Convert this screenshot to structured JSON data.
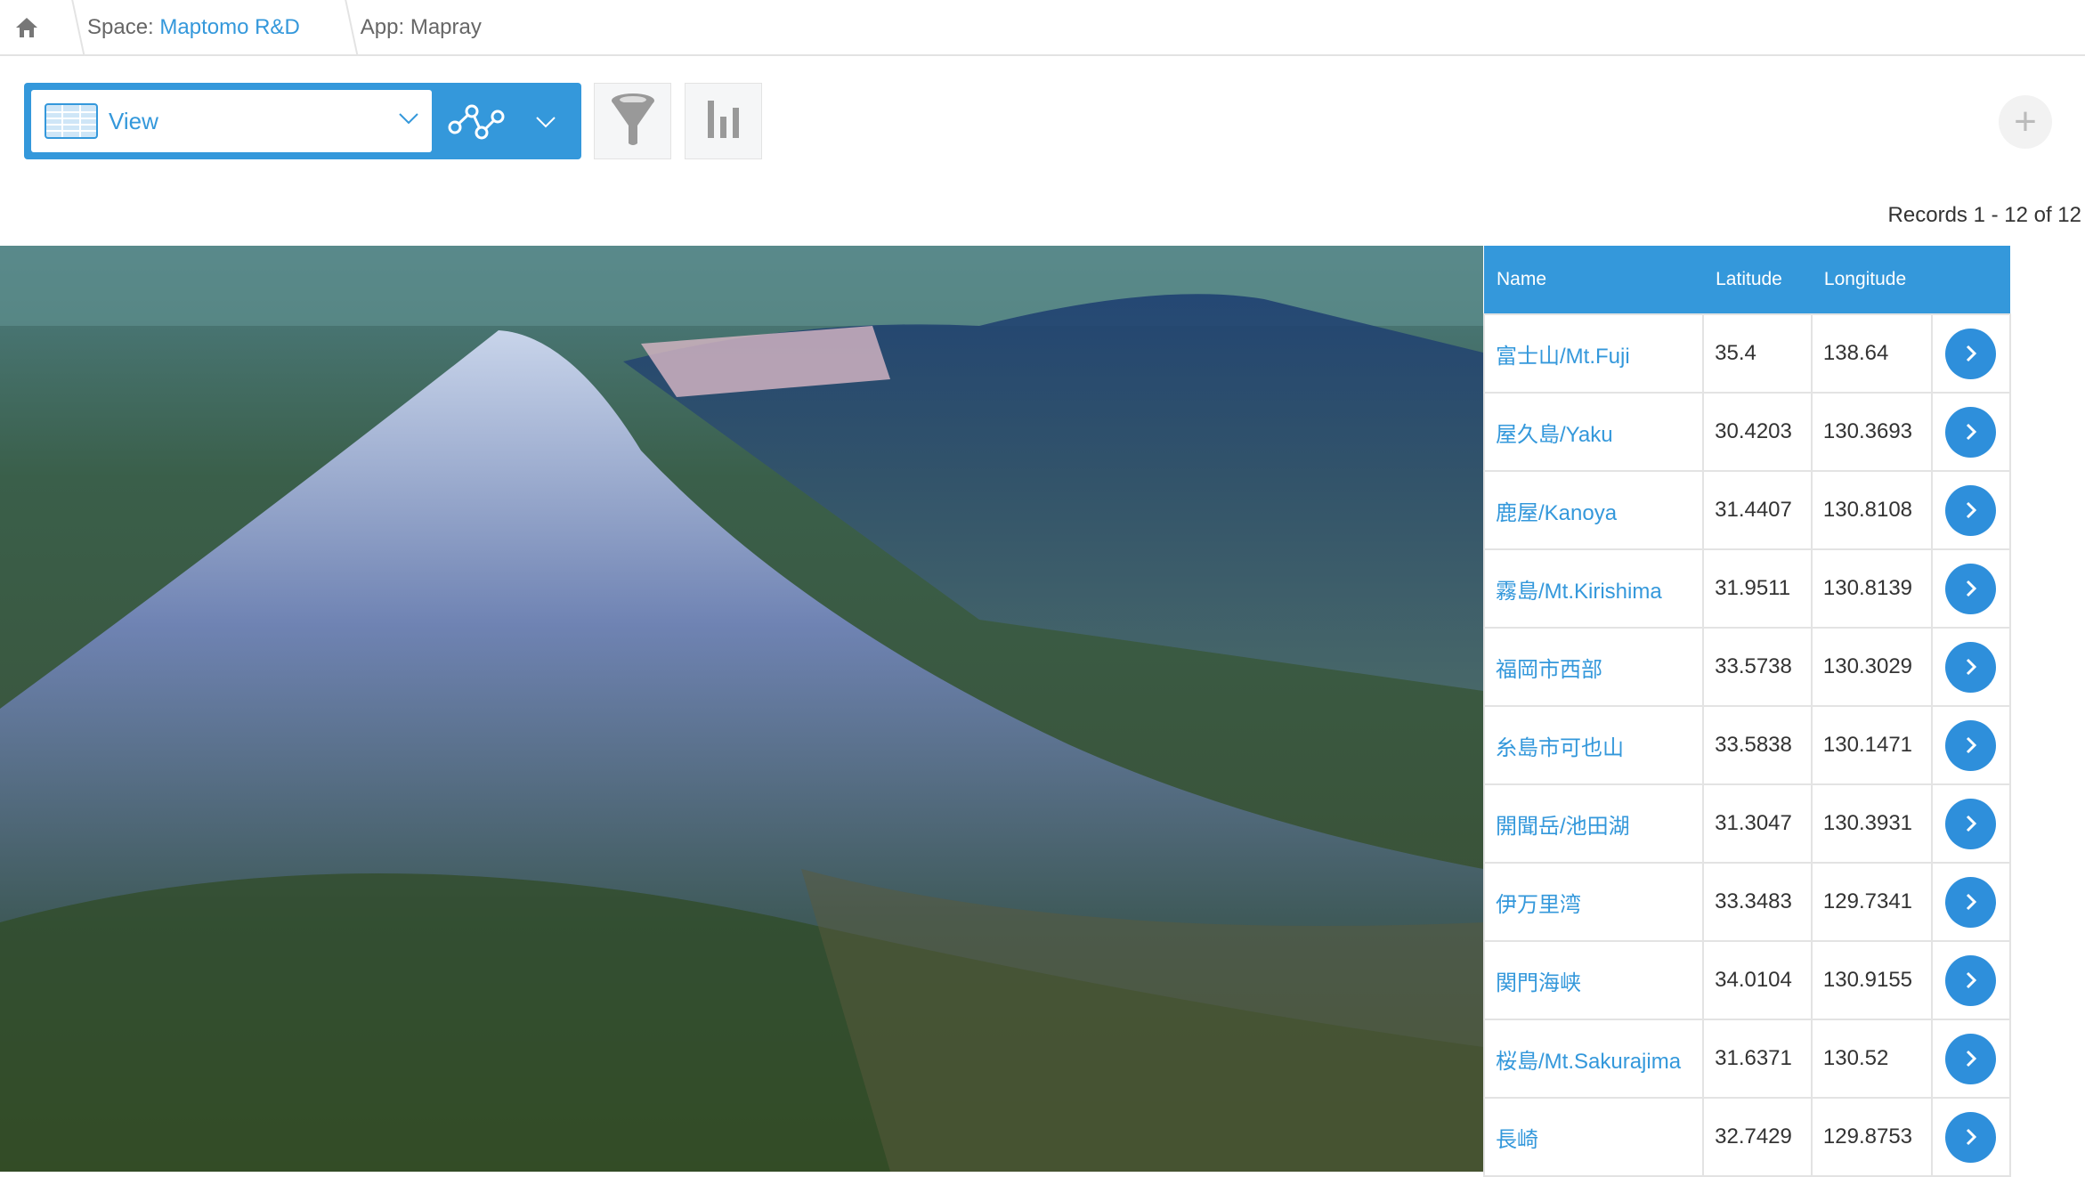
{
  "breadcrumb": {
    "space_prefix": "Space: ",
    "space_name": "Maptomo R&D",
    "app": "App: Mapray"
  },
  "toolbar": {
    "view_label": "View"
  },
  "records": "Records 1 - 12 of 12",
  "table": {
    "headers": [
      "Name",
      "Latitude",
      "Longitude"
    ],
    "rows": [
      {
        "name": "富士山/Mt.Fuji",
        "lat": "35.4",
        "lon": "138.64"
      },
      {
        "name": "屋久島/Yaku",
        "lat": "30.4203",
        "lon": "130.3693"
      },
      {
        "name": "鹿屋/Kanoya",
        "lat": "31.4407",
        "lon": "130.8108"
      },
      {
        "name": "霧島/Mt.Kirishima",
        "lat": "31.9511",
        "lon": "130.8139"
      },
      {
        "name": "福岡市西部",
        "lat": "33.5738",
        "lon": "130.3029"
      },
      {
        "name": "糸島市可也山",
        "lat": "33.5838",
        "lon": "130.1471"
      },
      {
        "name": "開聞岳/池田湖",
        "lat": "31.3047",
        "lon": "130.3931"
      },
      {
        "name": "伊万里湾",
        "lat": "33.3483",
        "lon": "129.7341"
      },
      {
        "name": "関門海峡",
        "lat": "34.0104",
        "lon": "130.9155"
      },
      {
        "name": "桜島/Mt.Sakurajima",
        "lat": "31.6371",
        "lon": "130.52"
      },
      {
        "name": "長崎",
        "lat": "32.7429",
        "lon": "129.8753"
      }
    ]
  },
  "colors": {
    "accent": "#3498db"
  }
}
